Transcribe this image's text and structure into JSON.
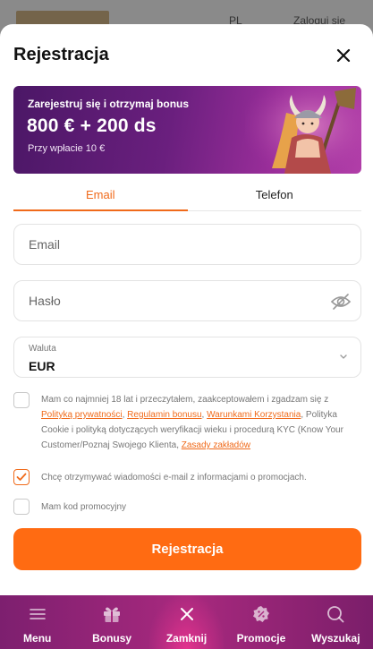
{
  "background": {
    "language": "PL",
    "login_label": "Zaloguj się"
  },
  "modal": {
    "title": "Rejestracja"
  },
  "banner": {
    "subtitle": "Zarejestruj się i otrzymaj bonus",
    "amount": "800 € + 200 ds",
    "note": "Przy wpłacie 10 €"
  },
  "tabs": [
    {
      "label": "Email",
      "active": true
    },
    {
      "label": "Telefon",
      "active": false
    }
  ],
  "form": {
    "email_placeholder": "Email",
    "password_placeholder": "Hasło",
    "currency_label": "Waluta",
    "currency_value": "EUR"
  },
  "consent": {
    "text_1": "Mam co najmniej 18 lat i przeczytałem, zaakceptowałem i zgadzam się z ",
    "link_privacy": "Polityką prywatności",
    "sep_1": ", ",
    "link_bonus": "Regulamin bonusu",
    "sep_2": ", ",
    "link_terms": "Warunkami Korzystania",
    "text_2": ", Polityka Cookie i polityką dotyczących weryfikacji wieku i procedurą KYC (Know Your Customer/Poznaj Swojego Klienta, ",
    "link_bets": "Zasady zakładów",
    "checked": false
  },
  "marketing": {
    "label": "Chcę otrzymywać wiadomości e-mail z informacjami o promocjach.",
    "checked": true
  },
  "promo": {
    "label": "Mam kod promocyjny",
    "checked": false
  },
  "submit_label": "Rejestracja",
  "nav": [
    {
      "label": "Menu",
      "icon": "menu-icon"
    },
    {
      "label": "Bonusy",
      "icon": "gift-icon"
    },
    {
      "label": "Zamknij",
      "icon": "close-icon",
      "active": true
    },
    {
      "label": "Promocje",
      "icon": "promo-badge-icon"
    },
    {
      "label": "Wyszukaj",
      "icon": "search-icon"
    }
  ],
  "colors": {
    "accent": "#ff6b12",
    "banner_purple": "#6a1f7e",
    "nav_magenta": "#a8297e"
  }
}
